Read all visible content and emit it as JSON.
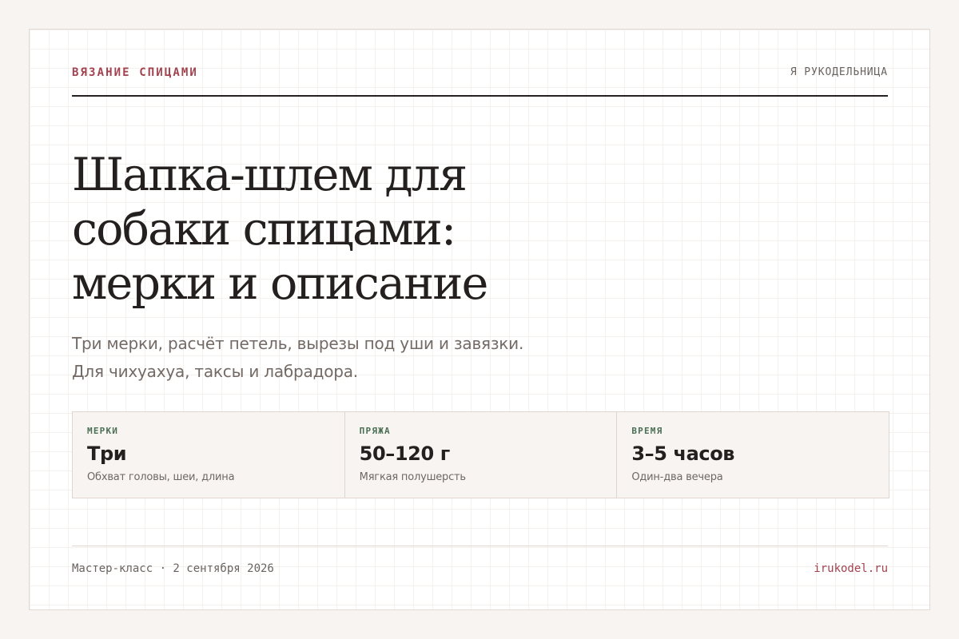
{
  "header": {
    "kicker": "ВЯЗАНИЕ СПИЦАМИ",
    "brand": "Я РУКОДЕЛЬНИЦА"
  },
  "article": {
    "title_lines": [
      "Шапка-шлем для",
      "собаки спицами:",
      "мерки и описание"
    ],
    "subtitle_lines": [
      "Три мерки, расчёт петель, вырезы под уши и завязки.",
      "Для чихуахуа, таксы и лабрадора."
    ]
  },
  "stats": [
    {
      "label": "МЕРКИ",
      "value": "Три",
      "note": "Обхват головы, шеи, длина"
    },
    {
      "label": "ПРЯЖА",
      "value": "50–120 г",
      "note": "Мягкая полушерсть"
    },
    {
      "label": "ВРЕМЯ",
      "value": "3–5 часов",
      "note": "Один-два вечера"
    }
  ],
  "footer": {
    "date": "Мастер-класс · 2 сентября 2026",
    "site": "irukodel.ru"
  },
  "colors": {
    "accent": "#a1434f",
    "stat_label": "#4a6f55",
    "text": "#252020",
    "background": "#f8f4f1"
  }
}
